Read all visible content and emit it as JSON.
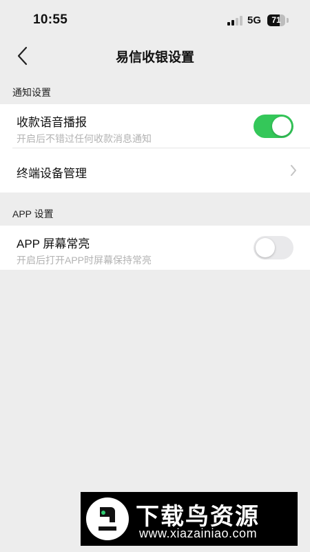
{
  "status_bar": {
    "time": "10:55",
    "network": "5G",
    "battery_level": "71",
    "signal_icon": "cellular-signal-icon",
    "battery_icon": "battery-icon"
  },
  "nav": {
    "title": "易信收银设置",
    "back_icon": "chevron-left-icon"
  },
  "sections": [
    {
      "header": "通知设置",
      "rows": [
        {
          "title": "收款语音播报",
          "subtitle": "开启后不错过任何收款消息通知",
          "control": "toggle",
          "enabled": true
        },
        {
          "title": "终端设备管理",
          "control": "chevron",
          "icon": "chevron-right-icon"
        }
      ]
    },
    {
      "header": "APP 设置",
      "rows": [
        {
          "title": "APP 屏幕常亮",
          "subtitle": "开启后打开APP时屏幕保持常亮",
          "control": "toggle",
          "enabled": false
        }
      ]
    }
  ],
  "watermark": {
    "title": "下载鸟资源",
    "url": "www.xiazainiao.com",
    "logo_icon": "bird-logo-icon"
  },
  "colors": {
    "background": "#ededed",
    "toggle_on": "#34c759",
    "toggle_off": "#e9e9eb",
    "subtitle": "#b3b3b3"
  }
}
